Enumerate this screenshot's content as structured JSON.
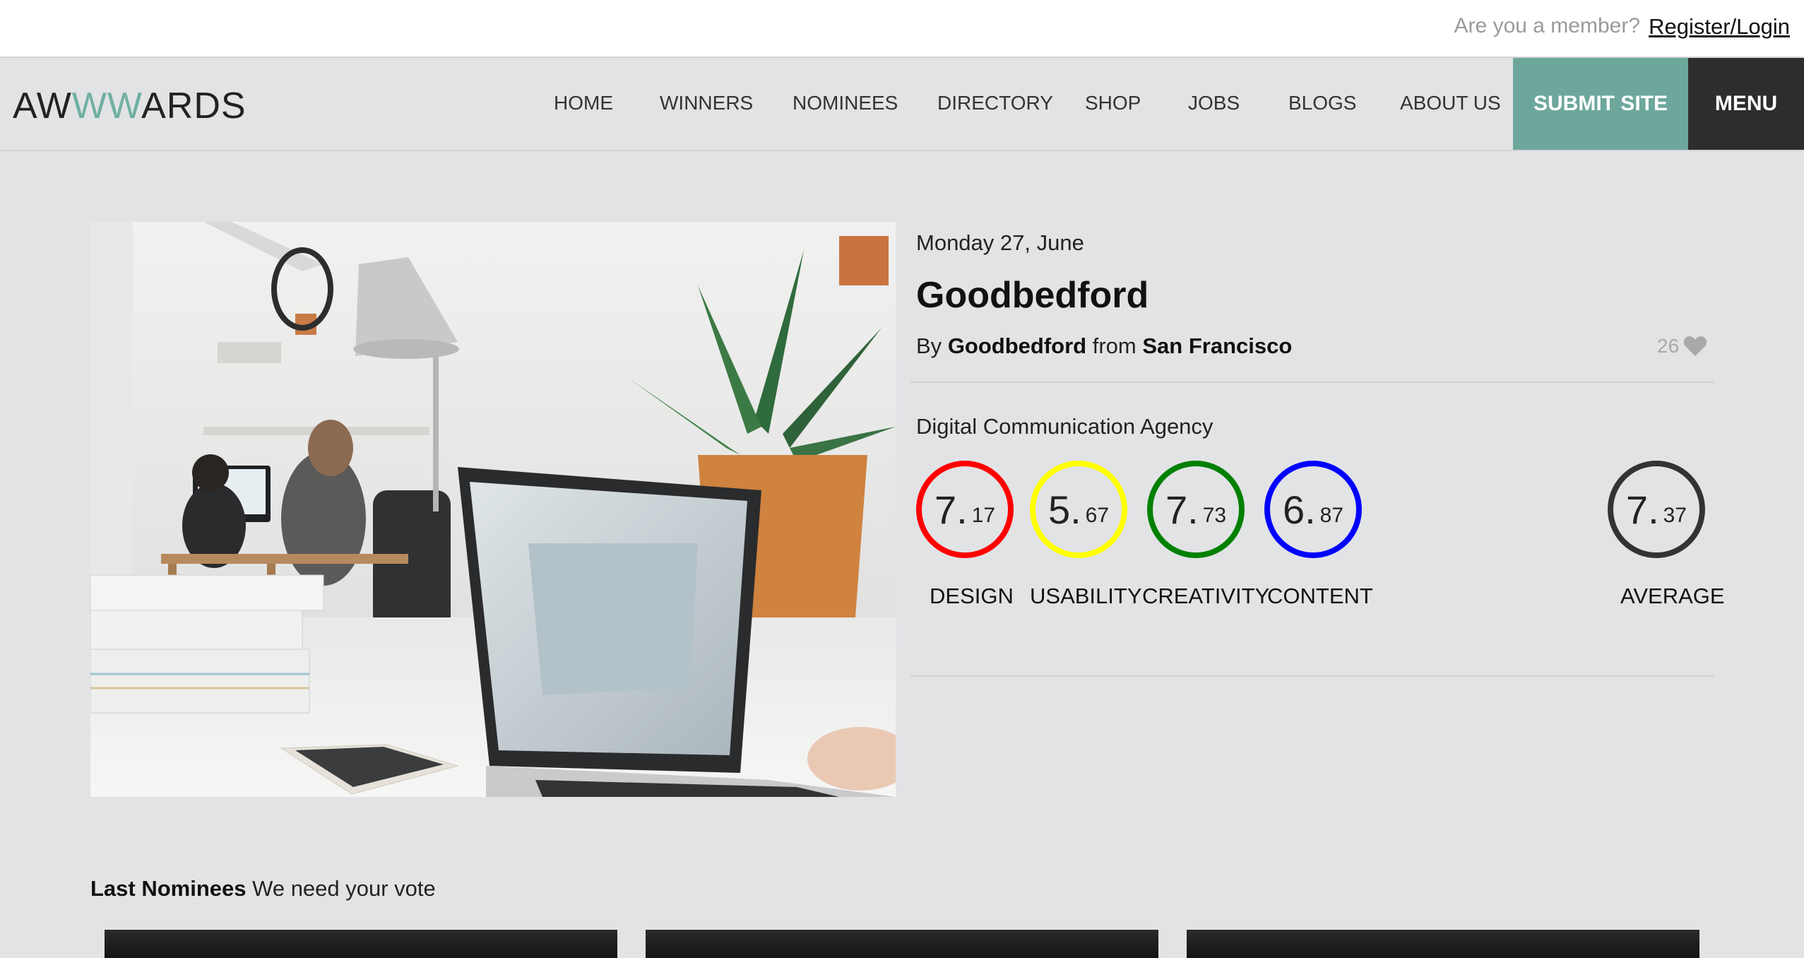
{
  "topbar": {
    "member_text": "Are you a member?",
    "login_label": "Register/Login"
  },
  "logo": {
    "part1": "AW",
    "part2": "WW",
    "part3": "ARDS"
  },
  "nav": {
    "items": [
      "HOME",
      "WINNERS",
      "NOMINEES",
      "DIRECTORY",
      "SHOP",
      "JOBS",
      "BLOGS",
      "ABOUT US"
    ],
    "submit_label": "SUBMIT SITE",
    "menu_label": "MENU"
  },
  "site": {
    "date": "Monday 27, June",
    "title": "Goodbedford",
    "by_prefix": "By",
    "author": "Goodbedford",
    "from_text": "from",
    "location": "San Francisco",
    "likes": "26",
    "category": "Digital Communication Agency"
  },
  "scores": [
    {
      "label": "DESIGN",
      "int": "7.",
      "dec": "17",
      "color": "#ff0000"
    },
    {
      "label": "USABILITY",
      "int": "5.",
      "dec": "67",
      "color": "#ffff00"
    },
    {
      "label": "CREATIVITY",
      "int": "7.",
      "dec": "73",
      "color": "#008000"
    },
    {
      "label": "CONTENT",
      "int": "6.",
      "dec": "87",
      "color": "#0000ff"
    },
    {
      "label": "AVERAGE",
      "int": "7.",
      "dec": "37",
      "color": "#333333"
    }
  ],
  "last_nominees": {
    "title": "Last Nominees",
    "subtitle": "We need your vote"
  },
  "colors": {
    "accent": "#6da79c",
    "logo_accent": "#6fb0a3",
    "menu_bg": "#2d2d2d"
  }
}
